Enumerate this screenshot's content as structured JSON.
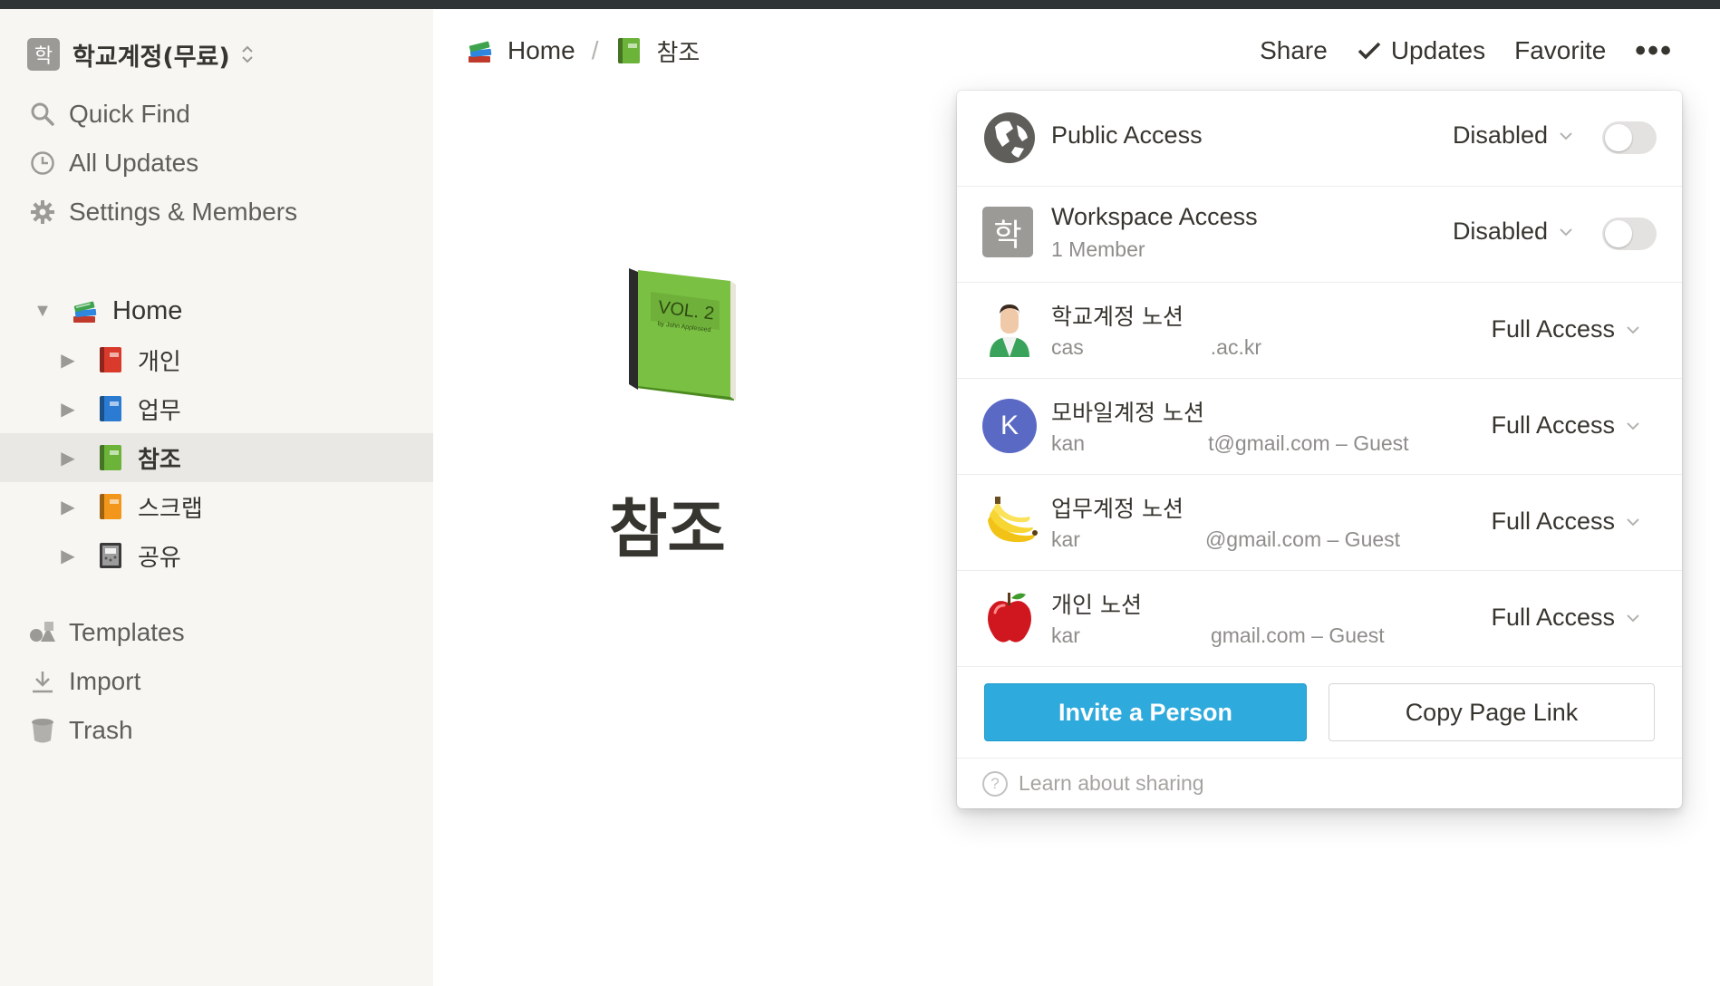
{
  "workspace": {
    "badge": "학",
    "name": "학교계정(무료)",
    "switch_icon": "up-down-chevron-icon"
  },
  "sidebar": {
    "nav": [
      {
        "label": "Quick Find",
        "icon": "search-icon"
      },
      {
        "label": "All Updates",
        "icon": "clock-icon"
      },
      {
        "label": "Settings & Members",
        "icon": "gear-icon"
      }
    ],
    "tree": [
      {
        "label": "Home",
        "toggle": "▼",
        "icon": "books-stack-icon"
      },
      {
        "label": "개인",
        "toggle": "▶",
        "icon": "red-book-icon",
        "color": "#d93a2b"
      },
      {
        "label": "업무",
        "toggle": "▶",
        "icon": "blue-book-icon",
        "color": "#2a7bd1"
      },
      {
        "label": "참조",
        "toggle": "▶",
        "icon": "green-book-icon",
        "color": "#6cb33a",
        "active": true
      },
      {
        "label": "스크랩",
        "toggle": "▶",
        "icon": "orange-book-icon",
        "color": "#f2961c"
      },
      {
        "label": "공유",
        "toggle": "▶",
        "icon": "notebook-icon",
        "color": "#444444"
      }
    ],
    "bottom": [
      {
        "label": "Templates",
        "icon": "templates-icon"
      },
      {
        "label": "Import",
        "icon": "download-icon"
      },
      {
        "label": "Trash",
        "icon": "trash-icon"
      }
    ]
  },
  "breadcrumb": {
    "home": "Home",
    "separator": "/",
    "current": "참조"
  },
  "header": {
    "share": "Share",
    "updates": "Updates",
    "favorite": "Favorite",
    "more": "•••"
  },
  "page": {
    "title": "참조",
    "icon": "green-book-icon"
  },
  "share_popover": {
    "public": {
      "title": "Public Access",
      "value": "Disabled",
      "enabled": false
    },
    "workspace": {
      "title": "Workspace Access",
      "subtitle": "1 Member",
      "badge": "학",
      "value": "Disabled",
      "enabled": false
    },
    "members": [
      {
        "name": "학교계정 노션",
        "email_start": "cas",
        "email_end": ".ac.kr",
        "access": "Full Access",
        "avatar": "person-avatar-icon"
      },
      {
        "name": "모바일계정 노션",
        "email_start": "kan",
        "email_end": "t@gmail.com – Guest",
        "access": "Full Access",
        "avatar": "letter-avatar",
        "initial": "K",
        "avatar_color": "#5a69c4"
      },
      {
        "name": "업무계정 노션",
        "email_start": "kar",
        "email_end": "@gmail.com – Guest",
        "access": "Full Access",
        "avatar": "banana-icon"
      },
      {
        "name": "개인 노션",
        "email_start": "kar",
        "email_end": "gmail.com – Guest",
        "access": "Full Access",
        "avatar": "apple-icon"
      }
    ],
    "invite_button": "Invite a Person",
    "copy_button": "Copy Page Link",
    "learn_link": "Learn about sharing",
    "accent": "#2eaadc"
  }
}
